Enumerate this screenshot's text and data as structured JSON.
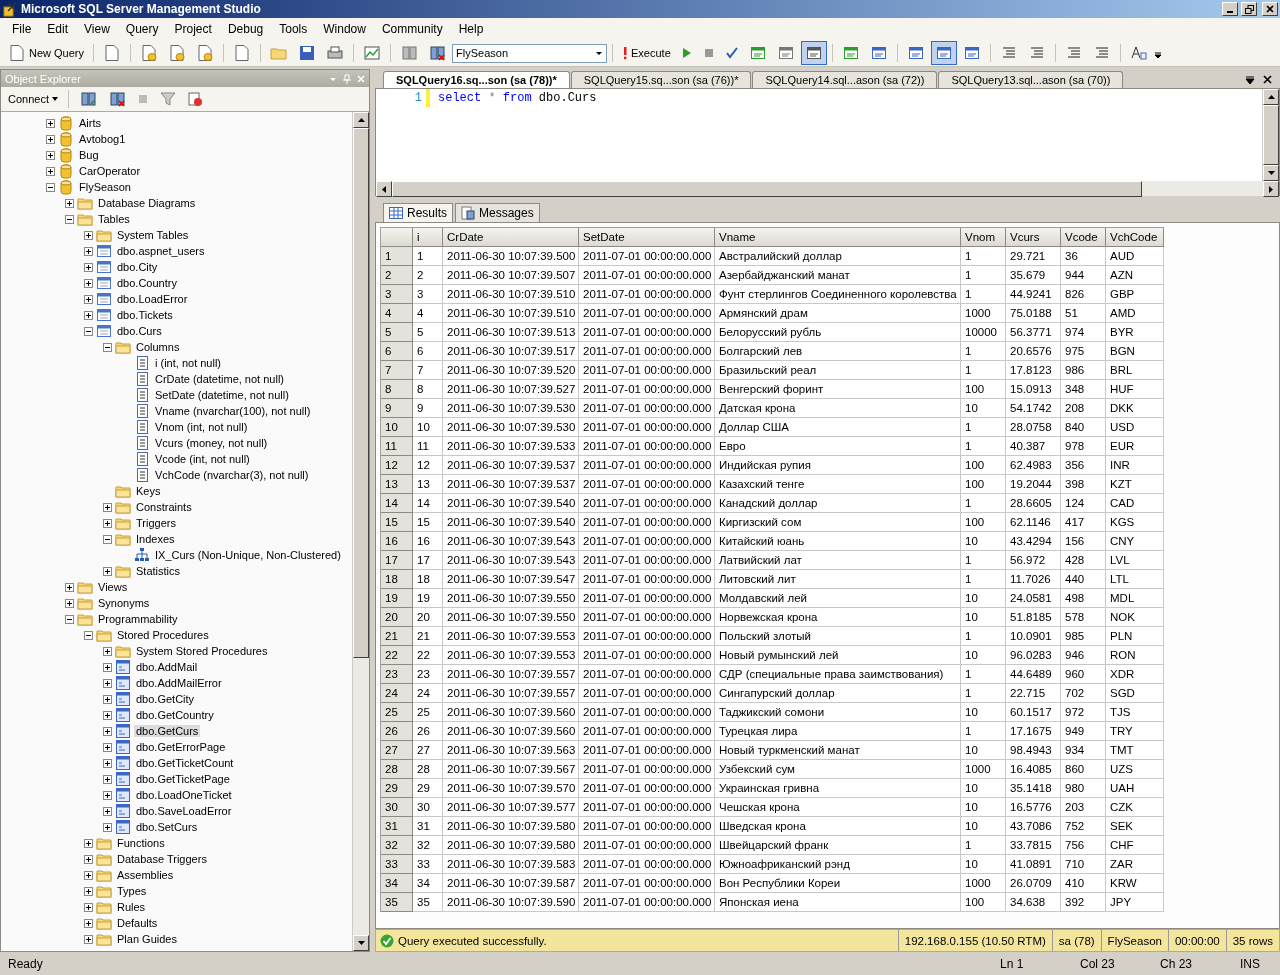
{
  "window": {
    "title": "Microsoft SQL Server Management Studio"
  },
  "menu": [
    "File",
    "Edit",
    "View",
    "Query",
    "Project",
    "Debug",
    "Tools",
    "Window",
    "Community",
    "Help"
  ],
  "toolbar": {
    "new_query": "New Query",
    "database": "FlySeason",
    "execute": "Execute"
  },
  "object_explorer": {
    "title": "Object Explorer",
    "connect": "Connect",
    "tree": [
      {
        "label": "Airts",
        "kind": "db",
        "expanded": false,
        "selected": false
      },
      {
        "label": "Avtobog1",
        "kind": "db",
        "expanded": false,
        "selected": false
      },
      {
        "label": "Bug",
        "kind": "db",
        "expanded": false,
        "selected": false
      },
      {
        "label": "CarOperator",
        "kind": "db",
        "expanded": false,
        "selected": false
      },
      {
        "label": "FlySeason",
        "kind": "db",
        "expanded": true,
        "selected": false,
        "children": [
          {
            "label": "Database Diagrams",
            "kind": "folder",
            "expanded": false,
            "selected": false
          },
          {
            "label": "Tables",
            "kind": "folder",
            "expanded": true,
            "selected": false,
            "children": [
              {
                "label": "System Tables",
                "kind": "folder",
                "expanded": false,
                "selected": false
              },
              {
                "label": "dbo.aspnet_users",
                "kind": "table",
                "expanded": false,
                "selected": false
              },
              {
                "label": "dbo.City",
                "kind": "table",
                "expanded": false,
                "selected": false
              },
              {
                "label": "dbo.Country",
                "kind": "table",
                "expanded": false,
                "selected": false
              },
              {
                "label": "dbo.LoadError",
                "kind": "table",
                "expanded": false,
                "selected": false
              },
              {
                "label": "dbo.Tickets",
                "kind": "table",
                "expanded": false,
                "selected": false
              },
              {
                "label": "dbo.Curs",
                "kind": "table",
                "expanded": true,
                "selected": false,
                "children": [
                  {
                    "label": "Columns",
                    "kind": "folder",
                    "expanded": true,
                    "selected": false,
                    "children": [
                      {
                        "label": "i (int, not null)",
                        "kind": "column",
                        "selected": false
                      },
                      {
                        "label": "CrDate (datetime, not null)",
                        "kind": "column",
                        "selected": false
                      },
                      {
                        "label": "SetDate (datetime, not null)",
                        "kind": "column",
                        "selected": false
                      },
                      {
                        "label": "Vname (nvarchar(100), not null)",
                        "kind": "column",
                        "selected": false
                      },
                      {
                        "label": "Vnom (int, not null)",
                        "kind": "column",
                        "selected": false
                      },
                      {
                        "label": "Vcurs (money, not null)",
                        "kind": "column",
                        "selected": false
                      },
                      {
                        "label": "Vcode (int, not null)",
                        "kind": "column",
                        "selected": false
                      },
                      {
                        "label": "VchCode (nvarchar(3), not null)",
                        "kind": "column",
                        "selected": false
                      }
                    ]
                  },
                  {
                    "label": "Keys",
                    "kind": "folder",
                    "selected": false
                  },
                  {
                    "label": "Constraints",
                    "kind": "folder",
                    "expanded": false,
                    "selected": false
                  },
                  {
                    "label": "Triggers",
                    "kind": "folder",
                    "expanded": false,
                    "selected": false
                  },
                  {
                    "label": "Indexes",
                    "kind": "folder",
                    "expanded": true,
                    "selected": false,
                    "children": [
                      {
                        "label": "IX_Curs (Non-Unique, Non-Clustered)",
                        "kind": "index",
                        "selected": false
                      }
                    ]
                  },
                  {
                    "label": "Statistics",
                    "kind": "folder",
                    "expanded": false,
                    "selected": false
                  }
                ]
              }
            ]
          },
          {
            "label": "Views",
            "kind": "folder",
            "expanded": false,
            "selected": false
          },
          {
            "label": "Synonyms",
            "kind": "folder",
            "expanded": false,
            "selected": false
          },
          {
            "label": "Programmability",
            "kind": "folder",
            "expanded": true,
            "selected": false,
            "children": [
              {
                "label": "Stored Procedures",
                "kind": "folder",
                "expanded": true,
                "selected": false,
                "children": [
                  {
                    "label": "System Stored Procedures",
                    "kind": "folder",
                    "expanded": false,
                    "selected": false
                  },
                  {
                    "label": "dbo.AddMail",
                    "kind": "proc",
                    "expanded": false,
                    "selected": false
                  },
                  {
                    "label": "dbo.AddMailError",
                    "kind": "proc",
                    "expanded": false,
                    "selected": false
                  },
                  {
                    "label": "dbo.GetCity",
                    "kind": "proc",
                    "expanded": false,
                    "selected": false
                  },
                  {
                    "label": "dbo.GetCountry",
                    "kind": "proc",
                    "expanded": false,
                    "selected": false
                  },
                  {
                    "label": "dbo.GetCurs",
                    "kind": "proc",
                    "expanded": false,
                    "selected": true
                  },
                  {
                    "label": "dbo.GetErrorPage",
                    "kind": "proc",
                    "expanded": false,
                    "selected": false
                  },
                  {
                    "label": "dbo.GetTicketCount",
                    "kind": "proc",
                    "expanded": false,
                    "selected": false
                  },
                  {
                    "label": "dbo.GetTicketPage",
                    "kind": "proc",
                    "expanded": false,
                    "selected": false
                  },
                  {
                    "label": "dbo.LoadOneTicket",
                    "kind": "proc",
                    "expanded": false,
                    "selected": false
                  },
                  {
                    "label": "dbo.SaveLoadError",
                    "kind": "proc",
                    "expanded": false,
                    "selected": false
                  },
                  {
                    "label": "dbo.SetCurs",
                    "kind": "proc",
                    "expanded": false,
                    "selected": false
                  }
                ]
              },
              {
                "label": "Functions",
                "kind": "folder",
                "expanded": false,
                "selected": false
              },
              {
                "label": "Database Triggers",
                "kind": "folder",
                "expanded": false,
                "selected": false
              },
              {
                "label": "Assemblies",
                "kind": "folder",
                "expanded": false,
                "selected": false
              },
              {
                "label": "Types",
                "kind": "folder",
                "expanded": false,
                "selected": false
              },
              {
                "label": "Rules",
                "kind": "folder",
                "expanded": false,
                "selected": false
              },
              {
                "label": "Defaults",
                "kind": "folder",
                "expanded": false,
                "selected": false
              },
              {
                "label": "Plan Guides",
                "kind": "folder",
                "expanded": false,
                "selected": false
              }
            ]
          }
        ]
      }
    ]
  },
  "document_tabs": [
    {
      "label": "SQLQuery16.sq...son (sa (78))*",
      "selected": true
    },
    {
      "label": "SQLQuery15.sq...son (sa (76))*",
      "selected": false
    },
    {
      "label": "SQLQuery14.sql...ason (sa (72))",
      "selected": false
    },
    {
      "label": "SQLQuery13.sql...ason (sa (70))",
      "selected": false
    }
  ],
  "editor": {
    "line_number": "1",
    "tokens": [
      {
        "kind": "keyword",
        "text": "select"
      },
      {
        "kind": "operator",
        "text": "*"
      },
      {
        "kind": "keyword",
        "text": "from"
      },
      {
        "kind": "text",
        "text": "dbo.Curs"
      }
    ]
  },
  "result_tabs": [
    {
      "label": "Results",
      "kind": "grid",
      "selected": true
    },
    {
      "label": "Messages",
      "kind": "messages",
      "selected": false
    }
  ],
  "results": {
    "columns": [
      "",
      "i",
      "CrDate",
      "SetDate",
      "Vname",
      "Vnom",
      "Vcurs",
      "Vcode",
      "VchCode"
    ],
    "rows": [
      [
        "1",
        "1",
        "2011-06-30 10:07:39.500",
        "2011-07-01 00:00:00.000",
        "Австралийский доллар",
        "1",
        "29.721",
        "36",
        "AUD"
      ],
      [
        "2",
        "2",
        "2011-06-30 10:07:39.507",
        "2011-07-01 00:00:00.000",
        "Азербайджанский манат",
        "1",
        "35.679",
        "944",
        "AZN"
      ],
      [
        "3",
        "3",
        "2011-06-30 10:07:39.510",
        "2011-07-01 00:00:00.000",
        "Фунт стерлингов Соединенного королевства",
        "1",
        "44.9241",
        "826",
        "GBP"
      ],
      [
        "4",
        "4",
        "2011-06-30 10:07:39.510",
        "2011-07-01 00:00:00.000",
        "Армянский драм",
        "1000",
        "75.0188",
        "51",
        "AMD"
      ],
      [
        "5",
        "5",
        "2011-06-30 10:07:39.513",
        "2011-07-01 00:00:00.000",
        "Белорусский рубль",
        "10000",
        "56.3771",
        "974",
        "BYR"
      ],
      [
        "6",
        "6",
        "2011-06-30 10:07:39.517",
        "2011-07-01 00:00:00.000",
        "Болгарский лев",
        "1",
        "20.6576",
        "975",
        "BGN"
      ],
      [
        "7",
        "7",
        "2011-06-30 10:07:39.520",
        "2011-07-01 00:00:00.000",
        "Бразильский реал",
        "1",
        "17.8123",
        "986",
        "BRL"
      ],
      [
        "8",
        "8",
        "2011-06-30 10:07:39.527",
        "2011-07-01 00:00:00.000",
        "Венгерский форинт",
        "100",
        "15.0913",
        "348",
        "HUF"
      ],
      [
        "9",
        "9",
        "2011-06-30 10:07:39.530",
        "2011-07-01 00:00:00.000",
        "Датская крона",
        "10",
        "54.1742",
        "208",
        "DKK"
      ],
      [
        "10",
        "10",
        "2011-06-30 10:07:39.530",
        "2011-07-01 00:00:00.000",
        "Доллар США",
        "1",
        "28.0758",
        "840",
        "USD"
      ],
      [
        "11",
        "11",
        "2011-06-30 10:07:39.533",
        "2011-07-01 00:00:00.000",
        "Евро",
        "1",
        "40.387",
        "978",
        "EUR"
      ],
      [
        "12",
        "12",
        "2011-06-30 10:07:39.537",
        "2011-07-01 00:00:00.000",
        "Индийская рупия",
        "100",
        "62.4983",
        "356",
        "INR"
      ],
      [
        "13",
        "13",
        "2011-06-30 10:07:39.537",
        "2011-07-01 00:00:00.000",
        "Казахский тенге",
        "100",
        "19.2044",
        "398",
        "KZT"
      ],
      [
        "14",
        "14",
        "2011-06-30 10:07:39.540",
        "2011-07-01 00:00:00.000",
        "Канадский доллар",
        "1",
        "28.6605",
        "124",
        "CAD"
      ],
      [
        "15",
        "15",
        "2011-06-30 10:07:39.540",
        "2011-07-01 00:00:00.000",
        "Киргизский сом",
        "100",
        "62.1146",
        "417",
        "KGS"
      ],
      [
        "16",
        "16",
        "2011-06-30 10:07:39.543",
        "2011-07-01 00:00:00.000",
        "Китайский юань",
        "10",
        "43.4294",
        "156",
        "CNY"
      ],
      [
        "17",
        "17",
        "2011-06-30 10:07:39.543",
        "2011-07-01 00:00:00.000",
        "Латвийский лат",
        "1",
        "56.972",
        "428",
        "LVL"
      ],
      [
        "18",
        "18",
        "2011-06-30 10:07:39.547",
        "2011-07-01 00:00:00.000",
        "Литовский лит",
        "1",
        "11.7026",
        "440",
        "LTL"
      ],
      [
        "19",
        "19",
        "2011-06-30 10:07:39.550",
        "2011-07-01 00:00:00.000",
        "Молдавский лей",
        "10",
        "24.0581",
        "498",
        "MDL"
      ],
      [
        "20",
        "20",
        "2011-06-30 10:07:39.550",
        "2011-07-01 00:00:00.000",
        "Норвежская крона",
        "10",
        "51.8185",
        "578",
        "NOK"
      ],
      [
        "21",
        "21",
        "2011-06-30 10:07:39.553",
        "2011-07-01 00:00:00.000",
        "Польский злотый",
        "1",
        "10.0901",
        "985",
        "PLN"
      ],
      [
        "22",
        "22",
        "2011-06-30 10:07:39.553",
        "2011-07-01 00:00:00.000",
        "Новый румынский лей",
        "10",
        "96.0283",
        "946",
        "RON"
      ],
      [
        "23",
        "23",
        "2011-06-30 10:07:39.557",
        "2011-07-01 00:00:00.000",
        "СДР (специальные права заимствования)",
        "1",
        "44.6489",
        "960",
        "XDR"
      ],
      [
        "24",
        "24",
        "2011-06-30 10:07:39.557",
        "2011-07-01 00:00:00.000",
        "Сингапурский доллар",
        "1",
        "22.715",
        "702",
        "SGD"
      ],
      [
        "25",
        "25",
        "2011-06-30 10:07:39.560",
        "2011-07-01 00:00:00.000",
        "Таджикский сомони",
        "10",
        "60.1517",
        "972",
        "TJS"
      ],
      [
        "26",
        "26",
        "2011-06-30 10:07:39.560",
        "2011-07-01 00:00:00.000",
        "Турецкая лира",
        "1",
        "17.1675",
        "949",
        "TRY"
      ],
      [
        "27",
        "27",
        "2011-06-30 10:07:39.563",
        "2011-07-01 00:00:00.000",
        "Новый туркменский манат",
        "10",
        "98.4943",
        "934",
        "TMT"
      ],
      [
        "28",
        "28",
        "2011-06-30 10:07:39.567",
        "2011-07-01 00:00:00.000",
        "Узбекский сум",
        "1000",
        "16.4085",
        "860",
        "UZS"
      ],
      [
        "29",
        "29",
        "2011-06-30 10:07:39.570",
        "2011-07-01 00:00:00.000",
        "Украинская гривна",
        "10",
        "35.1418",
        "980",
        "UAH"
      ],
      [
        "30",
        "30",
        "2011-06-30 10:07:39.577",
        "2011-07-01 00:00:00.000",
        "Чешская крона",
        "10",
        "16.5776",
        "203",
        "CZK"
      ],
      [
        "31",
        "31",
        "2011-06-30 10:07:39.580",
        "2011-07-01 00:00:00.000",
        "Шведская крона",
        "10",
        "43.7086",
        "752",
        "SEK"
      ],
      [
        "32",
        "32",
        "2011-06-30 10:07:39.580",
        "2011-07-01 00:00:00.000",
        "Швейцарский франк",
        "1",
        "33.7815",
        "756",
        "CHF"
      ],
      [
        "33",
        "33",
        "2011-06-30 10:07:39.583",
        "2011-07-01 00:00:00.000",
        "Южноафриканский рэнд",
        "10",
        "41.0891",
        "710",
        "ZAR"
      ],
      [
        "34",
        "34",
        "2011-06-30 10:07:39.587",
        "2011-07-01 00:00:00.000",
        "Вон Республики Кореи",
        "1000",
        "26.0709",
        "410",
        "KRW"
      ],
      [
        "35",
        "35",
        "2011-06-30 10:07:39.590",
        "2011-07-01 00:00:00.000",
        "Японская иена",
        "100",
        "34.638",
        "392",
        "JPY"
      ]
    ]
  },
  "query_status": {
    "message": "Query executed successfully.",
    "server": "192.168.0.155 (10.50 RTM)",
    "user": "sa (78)",
    "database": "FlySeason",
    "elapsed": "00:00:00",
    "rows": "35 rows"
  },
  "status_bar": {
    "state": "Ready",
    "line": "Ln 1",
    "column": "Col 23",
    "char": "Ch 23",
    "mode": "INS"
  }
}
